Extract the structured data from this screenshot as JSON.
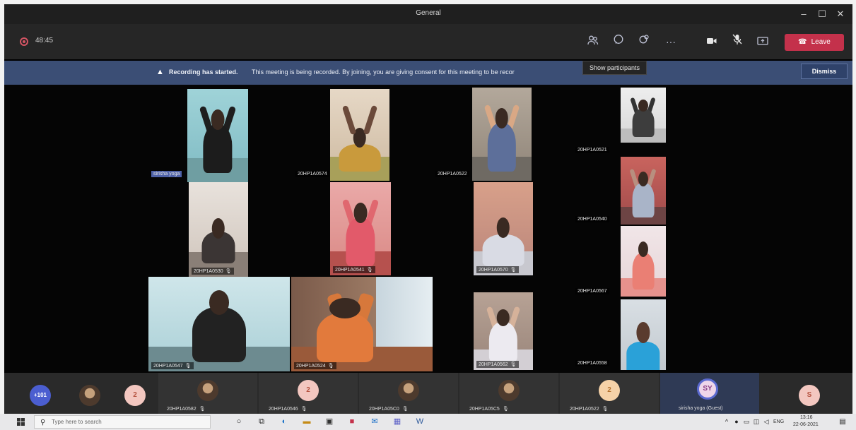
{
  "window": {
    "title": "General"
  },
  "toolbar": {
    "elapsed": "48:45",
    "leave_label": "Leave",
    "tooltip": "Show participants"
  },
  "banner": {
    "heading": "Recording has started.",
    "message": "This meeting is being recorded. By joining, you are giving consent for this meeting to be recor",
    "dismiss_label": "Dismiss"
  },
  "stage": {
    "spotlight_label": "sirisha yoga",
    "tiles": [
      {
        "label": "20HP1A0574"
      },
      {
        "label": "20HP1A0522"
      },
      {
        "label": "20HP1A0521"
      },
      {
        "label": "20HP1A0530"
      },
      {
        "label": "20HP1A0541"
      },
      {
        "label": "20HP1A0570"
      },
      {
        "label": "20HP1A0540"
      },
      {
        "label": "20HP1A0547"
      },
      {
        "label": "20HP1A0524"
      },
      {
        "label": "20HP1A0562"
      },
      {
        "label": "20HP1A0567"
      },
      {
        "label": "20HP1A0558"
      }
    ]
  },
  "strip": {
    "overflow": "+101",
    "participants": [
      {
        "initial": "2",
        "label": ""
      },
      {
        "initial": "",
        "label": "20HP1A0582"
      },
      {
        "initial": "2",
        "label": "20HP1A0546"
      },
      {
        "initial": "",
        "label": "20HP1A05C0"
      },
      {
        "initial": "",
        "label": "20HP1A05C5"
      },
      {
        "initial": "2",
        "label": "20HP1A0522"
      },
      {
        "initial": "SY",
        "label": "sirisha yoga (Guest)"
      },
      {
        "initial": "S",
        "label": ""
      }
    ]
  },
  "taskbar": {
    "search_placeholder": "Type here to search",
    "lang": "ENG",
    "time": "13:16",
    "date": "22-06-2021"
  },
  "colors": {
    "leave": "#c4314b",
    "banner": "#3b4e75",
    "accent": "#4b5ed0"
  }
}
